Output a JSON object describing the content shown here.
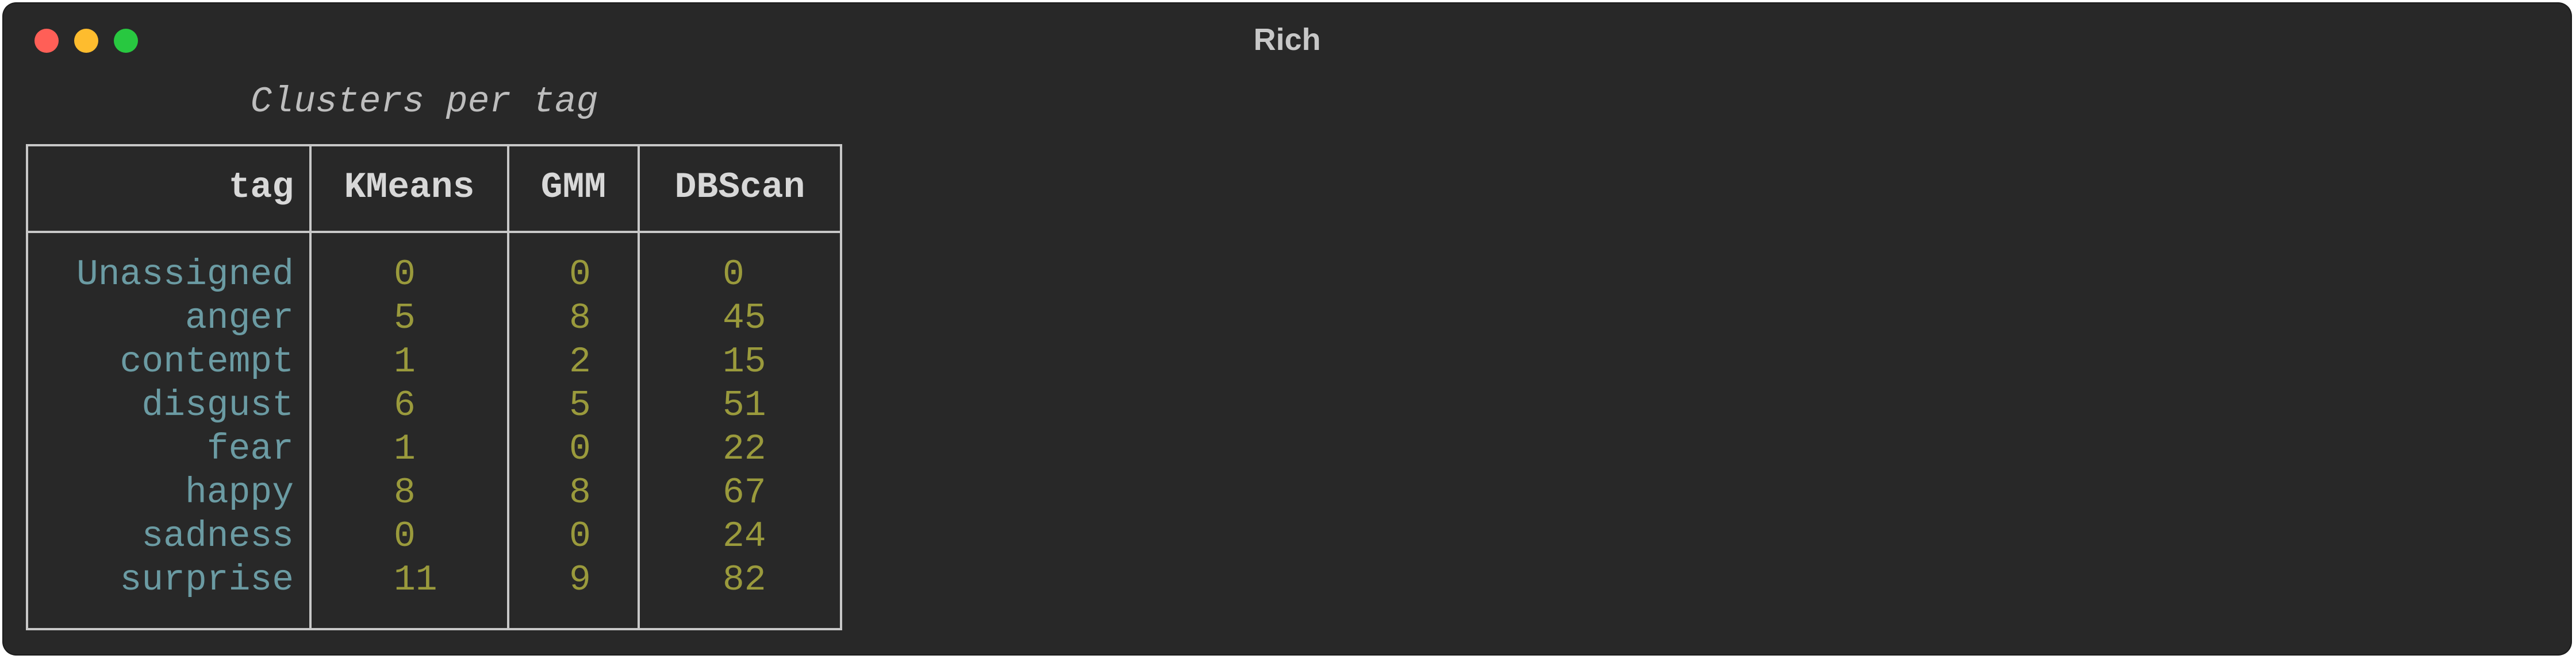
{
  "window": {
    "title": "Rich"
  },
  "table": {
    "caption": "Clusters per tag",
    "columns": [
      "tag",
      "KMeans",
      "GMM",
      "DBScan"
    ],
    "rows": [
      {
        "tag": "Unassigned",
        "kmeans": "0",
        "gmm": "0",
        "dbscan": "0"
      },
      {
        "tag": "anger",
        "kmeans": "5",
        "gmm": "8",
        "dbscan": "45"
      },
      {
        "tag": "contempt",
        "kmeans": "1",
        "gmm": "2",
        "dbscan": "15"
      },
      {
        "tag": "disgust",
        "kmeans": "6",
        "gmm": "5",
        "dbscan": "51"
      },
      {
        "tag": "fear",
        "kmeans": "1",
        "gmm": "0",
        "dbscan": "22"
      },
      {
        "tag": "happy",
        "kmeans": "8",
        "gmm": "8",
        "dbscan": "67"
      },
      {
        "tag": "sadness",
        "kmeans": "0",
        "gmm": "0",
        "dbscan": "24"
      },
      {
        "tag": "surprise",
        "kmeans": "11",
        "gmm": "9",
        "dbscan": "82"
      }
    ]
  },
  "colors": {
    "background": "#282828",
    "tag_text": "#6b9ba3",
    "number_text": "#9a9a3c",
    "border": "#c8c8c8"
  }
}
